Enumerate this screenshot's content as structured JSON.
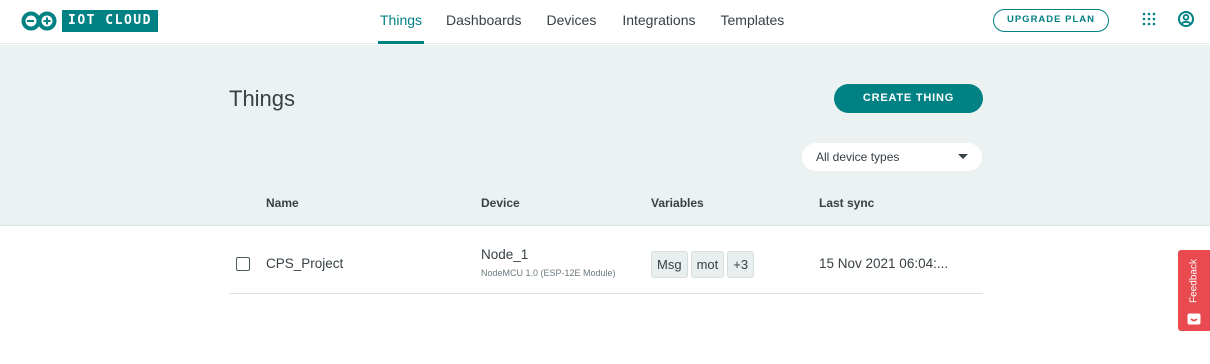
{
  "header": {
    "logo_text": "IOT CLOUD",
    "nav": [
      {
        "label": "Things",
        "active": true
      },
      {
        "label": "Dashboards",
        "active": false
      },
      {
        "label": "Devices",
        "active": false
      },
      {
        "label": "Integrations",
        "active": false
      },
      {
        "label": "Templates",
        "active": false
      }
    ],
    "upgrade_label": "UPGRADE PLAN",
    "icons": [
      "arduino-logo-icon",
      "apps-grid-icon",
      "account-icon"
    ]
  },
  "page": {
    "title": "Things",
    "create_label": "CREATE THING",
    "filter": {
      "selected": "All device types"
    }
  },
  "table": {
    "columns": [
      "Name",
      "Device",
      "Variables",
      "Last sync"
    ],
    "rows": [
      {
        "name": "CPS_Project",
        "device": "Node_1",
        "device_type": "NodeMCU 1.0 (ESP-12E Module)",
        "variables": [
          "Msg",
          "mot",
          "+3"
        ],
        "last_sync": "15 Nov 2021 06:04:..."
      }
    ]
  },
  "feedback": {
    "label": "Feedback"
  },
  "colors": {
    "accent": "#008184",
    "band": "#ecf1f1",
    "feedback": "#e84a4f"
  }
}
